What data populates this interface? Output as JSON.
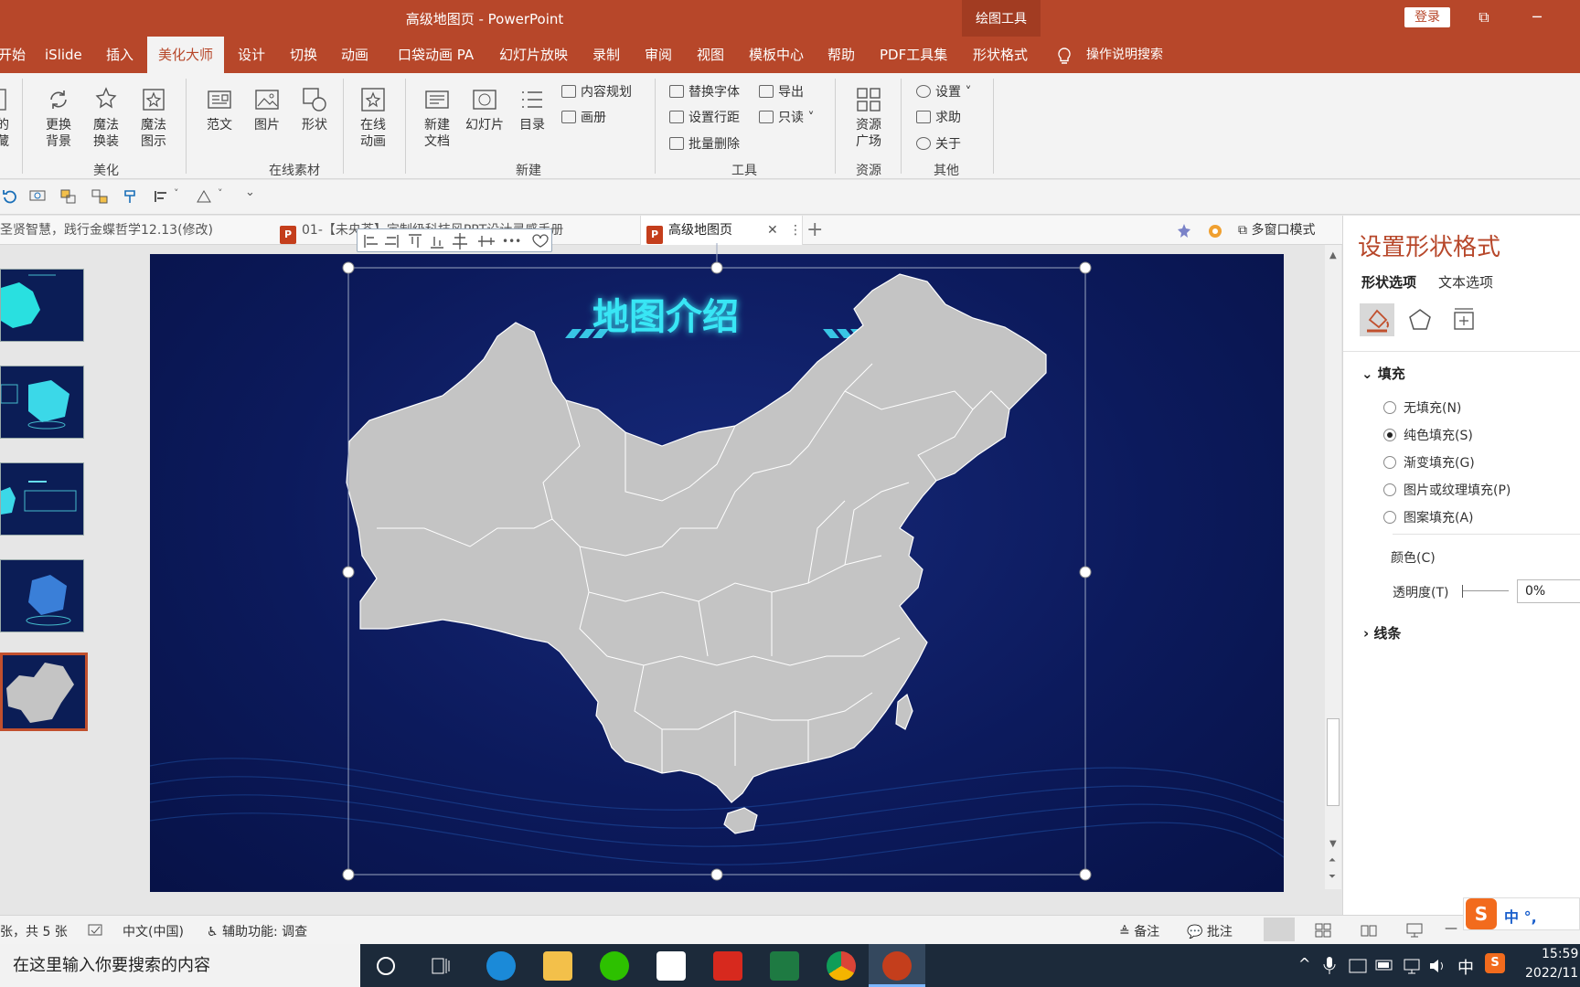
{
  "window": {
    "title": "高级地图页 - PowerPoint",
    "drawing_tools": "绘图工具",
    "login": "登录",
    "restore_glyph": "⧉",
    "minimize_glyph": "─"
  },
  "ribbon_tabs": {
    "t0": "开始",
    "t1": "iSlide",
    "t2": "插入",
    "t3": "美化大师",
    "t4": "设计",
    "t5": "切换",
    "t6": "动画",
    "t7": "口袋动画 PA",
    "t8": "幻灯片放映",
    "t9": "录制",
    "t10": "审阅",
    "t11": "视图",
    "t12": "模板中心",
    "t13": "帮助",
    "t14": "PDF工具集",
    "t15": "形状格式",
    "search": "操作说明搜索"
  },
  "ribbon": {
    "partial_left_top": "的",
    "partial_left_bottom": "藏",
    "change_bg": [
      "更换",
      "背景"
    ],
    "magic_change": [
      "魔法",
      "换装"
    ],
    "magic_icon": [
      "魔法",
      "图示"
    ],
    "group_beautify": "美化",
    "sample": "范文",
    "picture": "图片",
    "shape": "形状",
    "online_anim": [
      "在线",
      "动画"
    ],
    "group_online": "在线素材",
    "new_doc": [
      "新建",
      "文档"
    ],
    "slide": "幻灯片",
    "toc": "目录",
    "content_plan": "内容规划",
    "album": "画册",
    "group_new": "新建",
    "replace_font": "替换字体",
    "line_spacing": "设置行距",
    "batch_delete": "批量删除",
    "export": "导出",
    "readonly": "只读",
    "group_tools": "工具",
    "resource_square": [
      "资源",
      "广场"
    ],
    "group_resource": "资源",
    "settings": "设置",
    "help": "求助",
    "about": "关于",
    "group_other": "其他"
  },
  "doc_tabs": {
    "tab1": "圣贤智慧，践行金蝶哲学12.13(修改)",
    "tab2": "01-【未央荟】定制级科技风PPT设计灵感手册",
    "tab3": "高级地图页",
    "close": "✕",
    "more": "⋮",
    "add": "+",
    "multiwindow": "多窗口模式",
    "ppt_letter": "P"
  },
  "slide": {
    "title": "地图介绍"
  },
  "format_pane": {
    "title": "设置形状格式",
    "tab_shape": "形状选项",
    "tab_text": "文本选项",
    "fill_header": "填充",
    "fill_options": [
      "无填充(N)",
      "纯色填充(S)",
      "渐变填充(G)",
      "图片或纹理填充(P)",
      "图案填充(A)"
    ],
    "fill_selected": 1,
    "color_label": "颜色(C)",
    "transparency_label": "透明度(T)",
    "transparency_value": "0%",
    "line_header": "线条"
  },
  "status": {
    "slide_count": "张，共 5 张",
    "language": "中文(中国)",
    "accessibility": "辅助功能: 调查",
    "notes": "备注",
    "comments": "批注"
  },
  "taskbar": {
    "search_placeholder": "在这里输入你要搜索的内容",
    "ime": "中",
    "ime_logo": "S",
    "ime_bar": "中 °,",
    "time": "15:59",
    "date": "2022/11"
  },
  "colors": {
    "accent": "#b7472a",
    "slide_bg": "#0c1a5c",
    "map_fill": "#c4c4c4",
    "title_glow": "#38e6f5"
  },
  "thumbnails": {
    "count": 5,
    "selected": 5
  }
}
